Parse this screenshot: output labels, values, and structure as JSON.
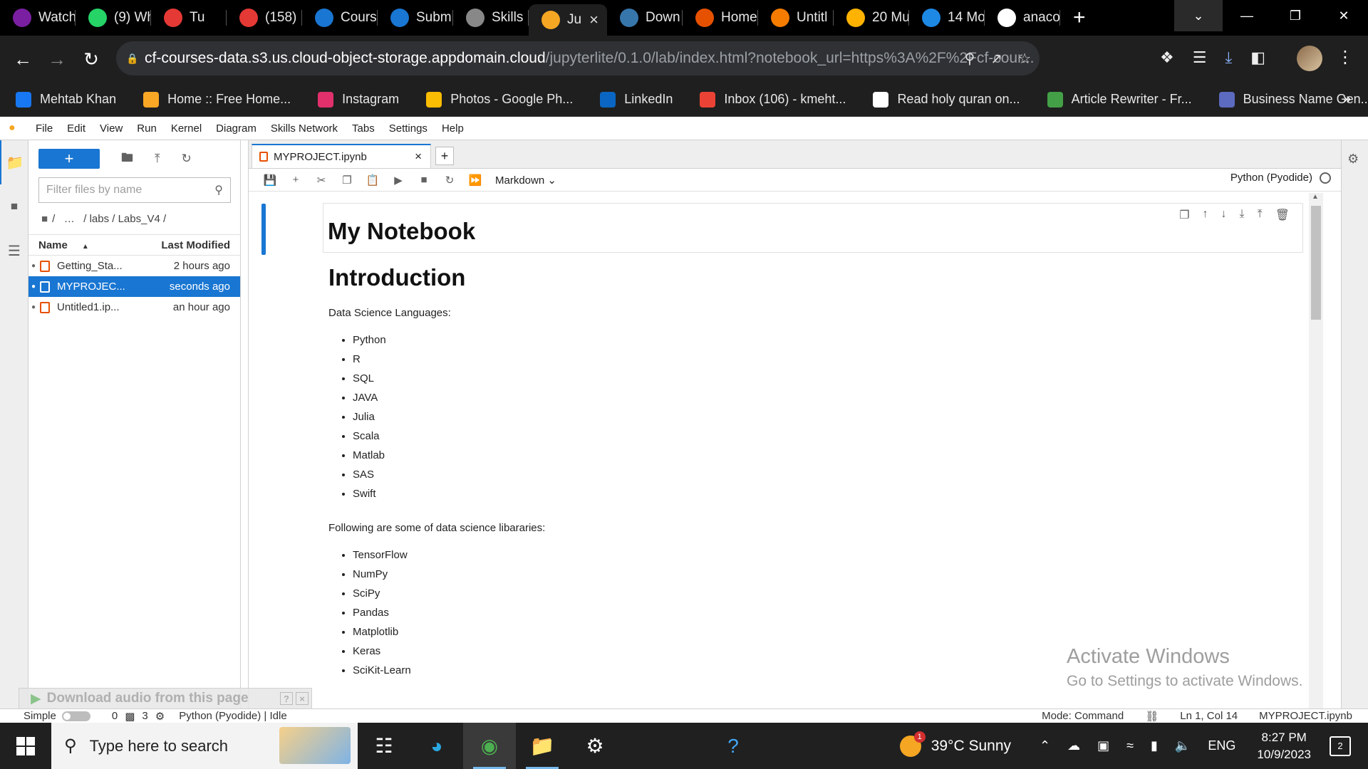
{
  "browser": {
    "tabs": [
      {
        "title": "Watch",
        "icon": "play-icon",
        "color": "#7b1fa2"
      },
      {
        "title": "(9) Wh",
        "icon": "whatsapp-icon",
        "color": "#25d366"
      },
      {
        "title": "Tu",
        "icon": "youtube-icon",
        "color": "#e53935"
      },
      {
        "title": "(158)",
        "icon": "youtube-icon",
        "color": "#e53935"
      },
      {
        "title": "Cours",
        "icon": "coursera-icon",
        "color": "#1976d2"
      },
      {
        "title": "Subm",
        "icon": "coursera-icon",
        "color": "#1976d2"
      },
      {
        "title": "Skills",
        "icon": "globe-icon",
        "color": "#888888"
      },
      {
        "title": "Ju",
        "icon": "jupyter-icon",
        "color": "#f5a623"
      },
      {
        "title": "Down",
        "icon": "python-icon",
        "color": "#3776ab"
      },
      {
        "title": "Home",
        "icon": "anaconda-icon",
        "color": "#e65100"
      },
      {
        "title": "Untitl",
        "icon": "notebook-icon",
        "color": "#f57c00"
      },
      {
        "title": "20 Mu",
        "icon": "chart-icon",
        "color": "#ffb300"
      },
      {
        "title": "14 Mo",
        "icon": "edge-icon",
        "color": "#1e88e5"
      },
      {
        "title": "anaco",
        "icon": "google-icon",
        "color": "#ffffff"
      }
    ],
    "url_host": "cf-courses-data.s3.us.cloud-object-storage.appdomain.cloud",
    "url_path": "/jupyterlite/0.1.0/lab/index.html?notebook_url=https%3A%2F%2Fcf-cour...",
    "bookmarks": [
      {
        "label": "Mehtab Khan",
        "icon": "facebook-icon",
        "color": "#1877f2"
      },
      {
        "label": "Home :: Free Home...",
        "icon": "s-icon",
        "color": "#f9a825"
      },
      {
        "label": "Instagram",
        "icon": "instagram-icon",
        "color": "#e1306c"
      },
      {
        "label": "Photos - Google Ph...",
        "icon": "photos-icon",
        "color": "#fbbc04"
      },
      {
        "label": "LinkedIn",
        "icon": "linkedin-icon",
        "color": "#0a66c2"
      },
      {
        "label": "Inbox (106) - kmeht...",
        "icon": "gmail-icon",
        "color": "#ea4335"
      },
      {
        "label": "Read holy quran on...",
        "icon": "globe-icon",
        "color": "#ffffff"
      },
      {
        "label": "Article Rewriter - Fr...",
        "icon": "rewriter-icon",
        "color": "#43a047"
      },
      {
        "label": "Business Name Gen...",
        "icon": "n-icon",
        "color": "#5c6bc0"
      }
    ]
  },
  "jupyter": {
    "menus": [
      "File",
      "Edit",
      "View",
      "Run",
      "Kernel",
      "Diagram",
      "Skills Network",
      "Tabs",
      "Settings",
      "Help"
    ],
    "filebrowser": {
      "new_label": "+",
      "filter_placeholder": "Filter files by name",
      "breadcrumb": "/   …   / labs / Labs_V4 /",
      "col_name": "Name",
      "col_modified": "Last Modified",
      "files": [
        {
          "name": "Getting_Sta...",
          "modified": "2 hours ago",
          "selected": false
        },
        {
          "name": "MYPROJEC...",
          "modified": "seconds ago",
          "selected": true
        },
        {
          "name": "Untitled1.ip...",
          "modified": "an hour ago",
          "selected": false
        }
      ]
    },
    "notebook": {
      "tab_title": "MYPROJECT.ipynb",
      "cell_type": "Markdown",
      "kernel": "Python (Pyodide)",
      "title": "My Notebook",
      "heading": "Introduction",
      "para1": "Data Science Languages:",
      "languages": [
        "Python",
        "R",
        "SQL",
        "JAVA",
        "Julia",
        "Scala",
        "Matlab",
        "SAS",
        "Swift"
      ],
      "para2": "Following are some of data science libararies:",
      "libraries": [
        "TensorFlow",
        "NumPy",
        "SciPy",
        "Pandas",
        "Matplotlib",
        "Keras",
        "SciKit-Learn"
      ]
    },
    "statusbar": {
      "mode_label": "Simple",
      "count_a": "0",
      "count_b": "3",
      "kernel_status": "Python (Pyodide) | Idle",
      "mode": "Mode: Command",
      "position": "Ln 1, Col 14",
      "file": "MYPROJECT.ipynb"
    }
  },
  "overlay": {
    "download_audio": "Download audio from this page",
    "watermark_title": "Activate Windows",
    "watermark_sub": "Go to Settings to activate Windows."
  },
  "taskbar": {
    "search_placeholder": "Type here to search",
    "weather": "39°C  Sunny",
    "lang": "ENG",
    "time": "8:27 PM",
    "date": "10/9/2023",
    "notif_count": "2"
  }
}
